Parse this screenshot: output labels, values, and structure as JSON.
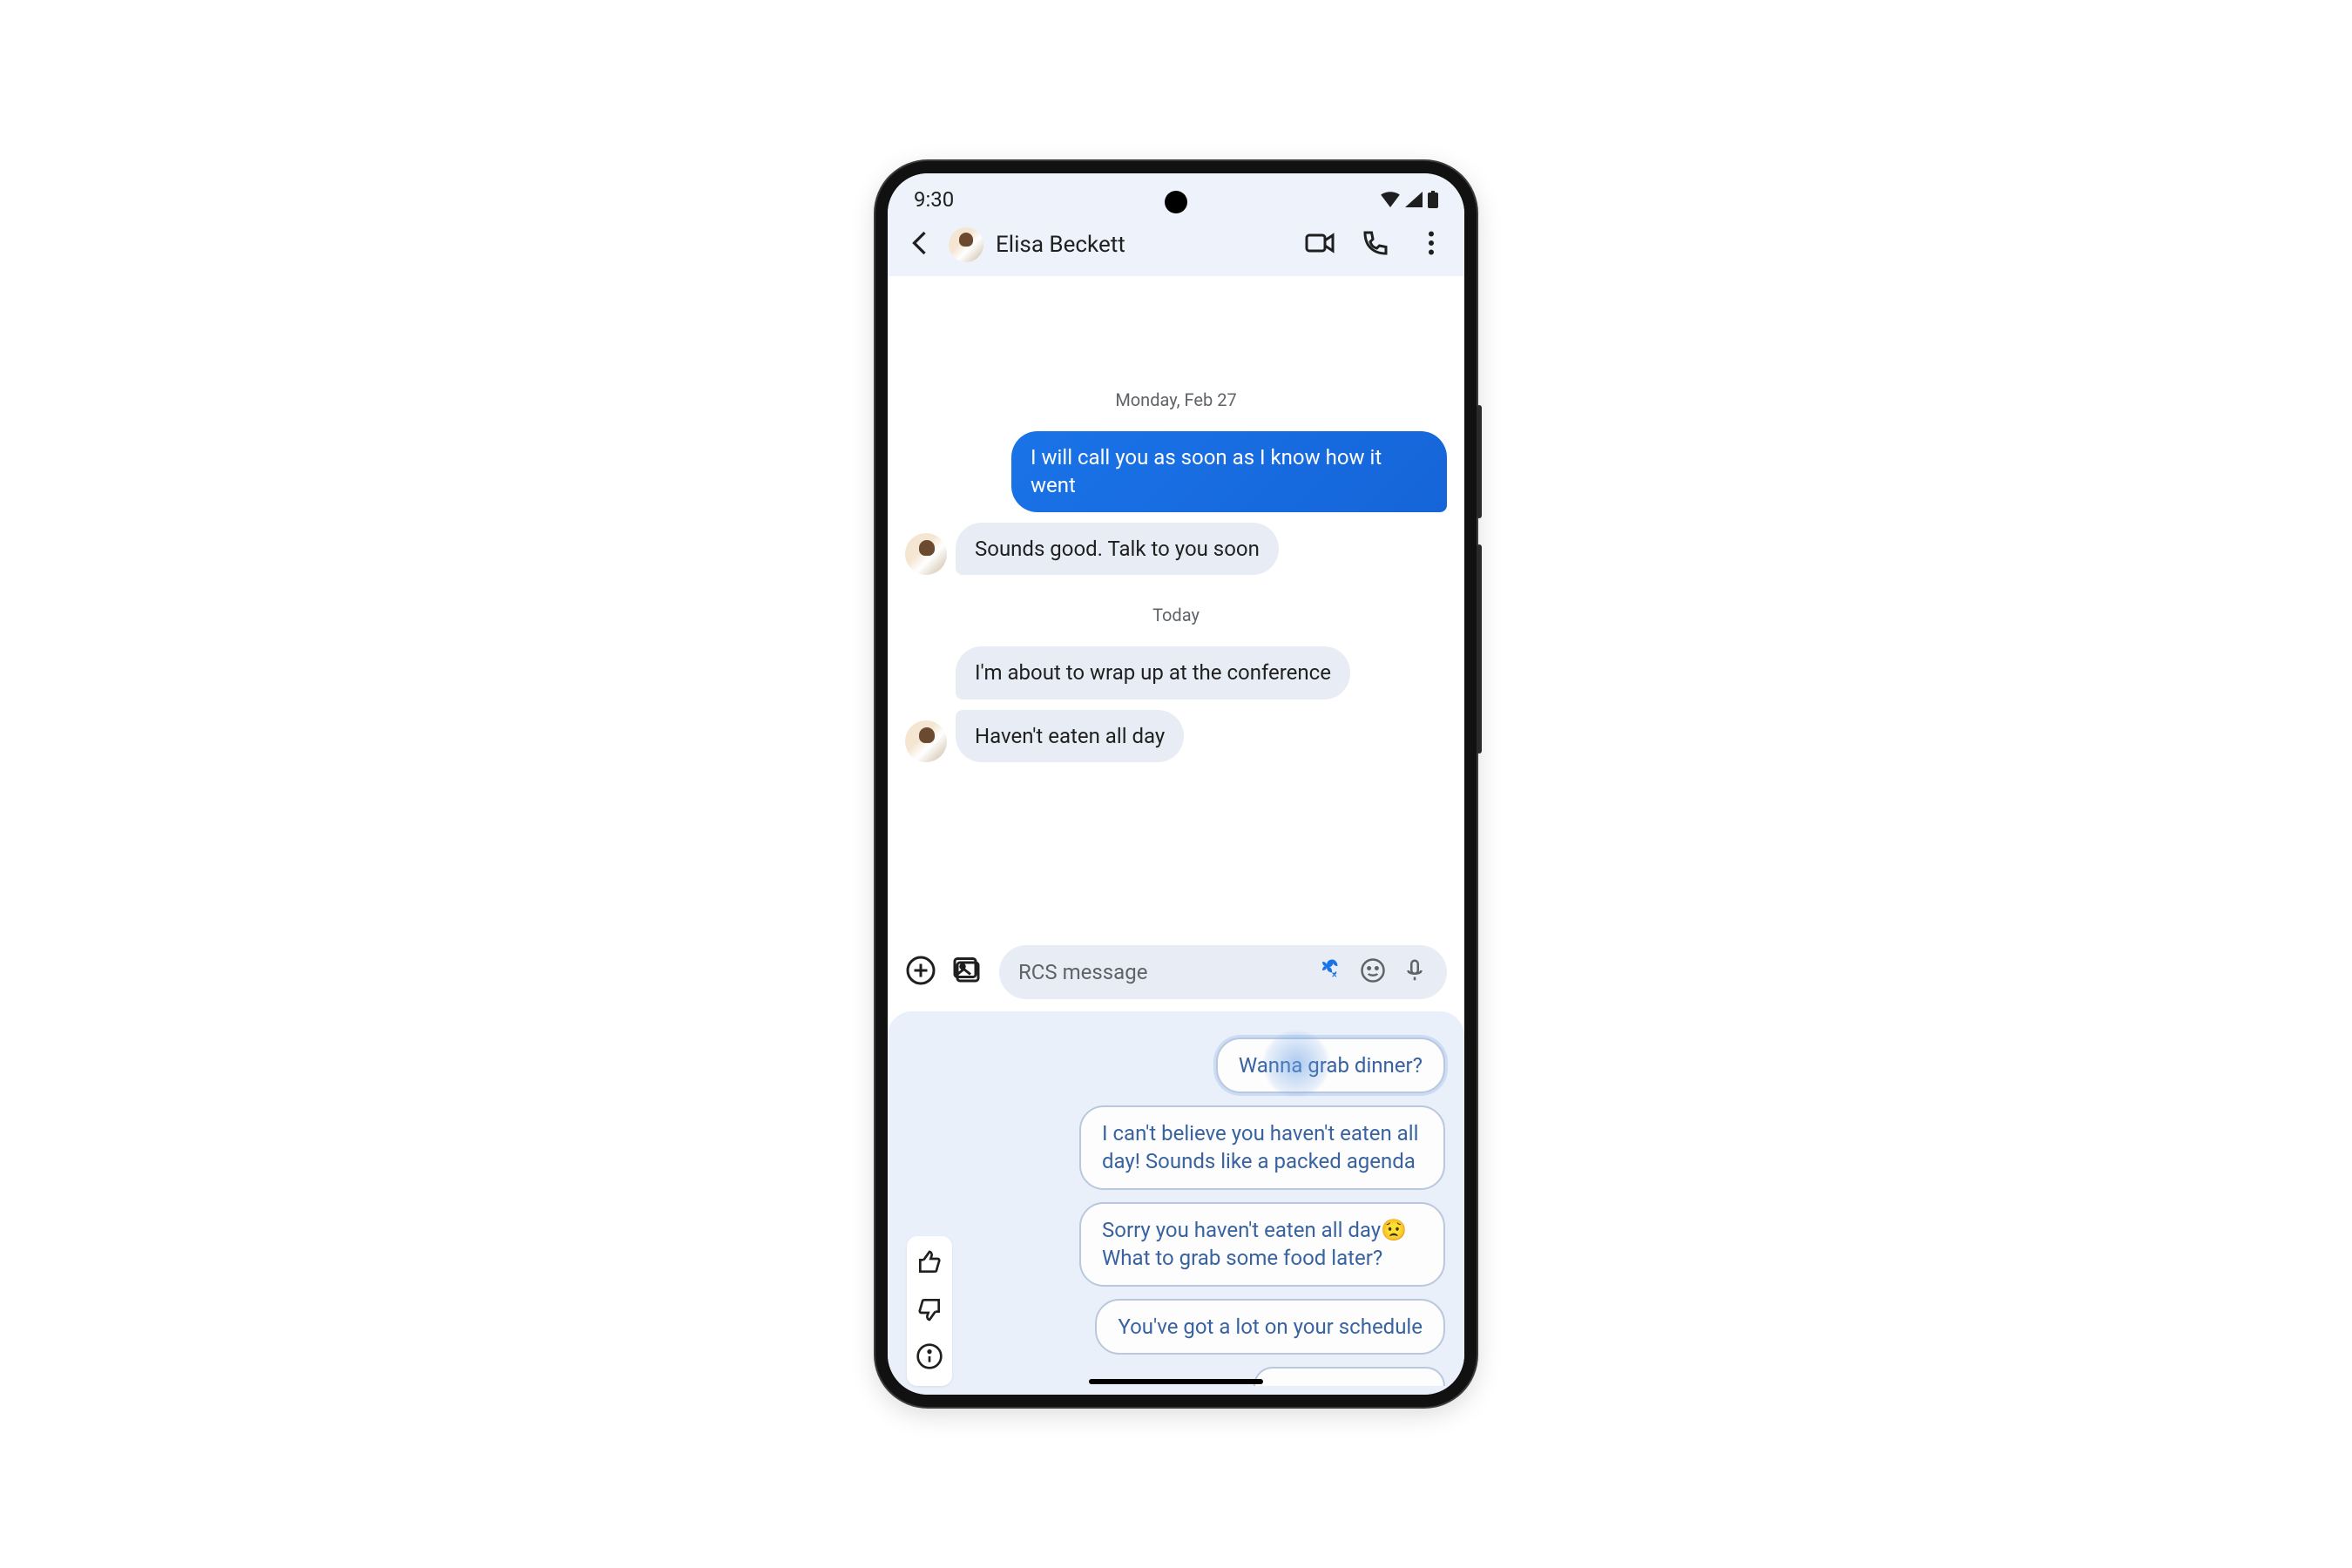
{
  "status_bar": {
    "time": "9:30"
  },
  "header": {
    "contact_name": "Elisa Beckett"
  },
  "conversation": {
    "date1": "Monday, Feb 27",
    "sent1": "I will call you as soon as I know how it went",
    "recv1": "Sounds good. Talk to you soon",
    "date2": "Today",
    "recv2": "I'm about to wrap up at the conference",
    "recv3": "Haven't eaten all day"
  },
  "composer": {
    "placeholder": "RCS message"
  },
  "suggestions": {
    "s1": "Wanna grab dinner?",
    "s2": "I can't believe you haven't eaten all day! Sounds like a packed agenda",
    "s3": "Sorry you haven't eaten all day😟 What to grab some food later?",
    "s4": "You've got a lot on your schedule"
  }
}
